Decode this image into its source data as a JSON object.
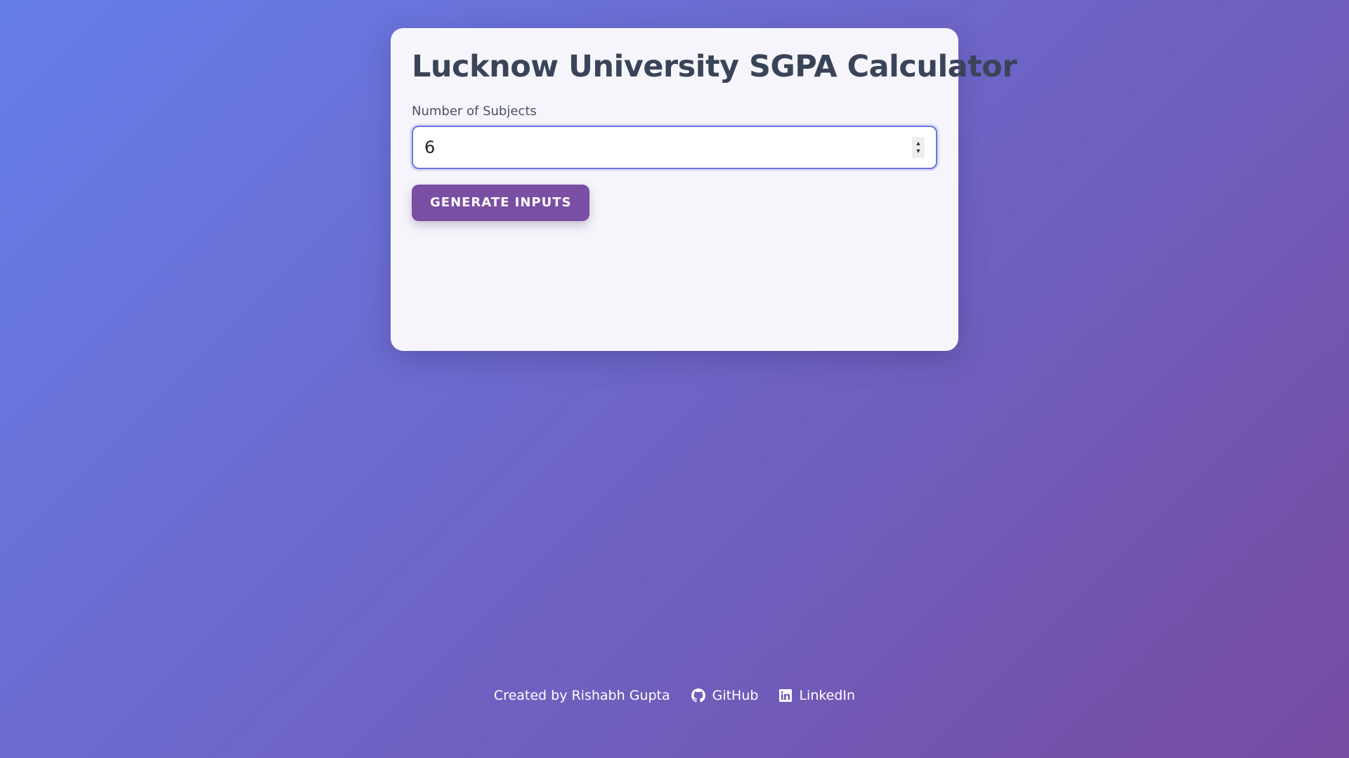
{
  "card": {
    "title": "Lucknow University SGPA Calculator",
    "subjects_label": "Number of Subjects",
    "subjects_value": "6",
    "generate_button": "GENERATE INPUTS"
  },
  "footer": {
    "credit": "Created by Rishabh Gupta",
    "github_label": "GitHub",
    "github_icon": "github-icon",
    "linkedin_label": "LinkedIn",
    "linkedin_icon": "linkedin-icon"
  },
  "colors": {
    "gradient_start": "#667eea",
    "gradient_end": "#764ba2",
    "card_bg": "#f6f5fb",
    "title": "#3a4459",
    "button_bg": "#7a4ea3",
    "input_border": "#6b74e0"
  }
}
